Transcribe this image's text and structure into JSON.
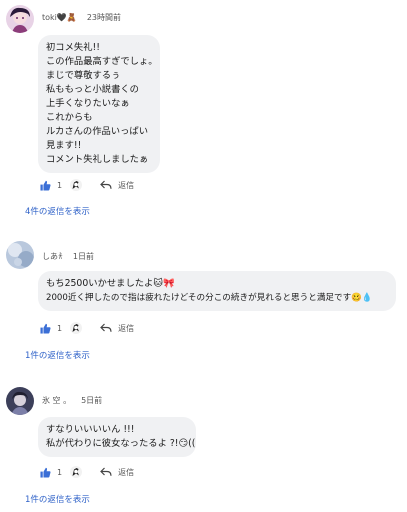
{
  "comments": [
    {
      "author": "toki🖤🧸",
      "time": "23時間前",
      "lines": [
        "初コメ失礼!!",
        "この作品最高すぎでしょ。",
        "まじで尊敬するぅ",
        "私ももっと小説書くの",
        "上手くなりたいなぁ",
        "これからも",
        "ルカさんの作品いっぱい",
        "見ます!!",
        "コメント失礼しましたぁ"
      ],
      "like_count": "1",
      "reply_label": "返信",
      "view_replies": "4件の返信を表示"
    },
    {
      "author": "しあ𐀪",
      "time": "1日前",
      "lines": [
        "もち2500いかせましたよ🐱🎀",
        "2000近く押したので指は疲れたけどその分この続きが見れると思うと満足です🥴💧"
      ],
      "like_count": "1",
      "reply_label": "返信",
      "view_replies": "1件の返信を表示"
    },
    {
      "author": "氷 空 。",
      "time": "5日前",
      "lines": [
        "すなりいいいいん !!!",
        "私が代わりに彼女なったるよ ?!😏(("
      ],
      "like_count": "1",
      "reply_label": "返信",
      "view_replies": "1件の返信を表示"
    }
  ],
  "colors": {
    "like": "#3b6fd6",
    "link": "#2f62c8",
    "bubble": "#f0f1f3"
  },
  "icons": {
    "like": "thumbs-up-icon",
    "reply": "reply-arrow-icon"
  }
}
